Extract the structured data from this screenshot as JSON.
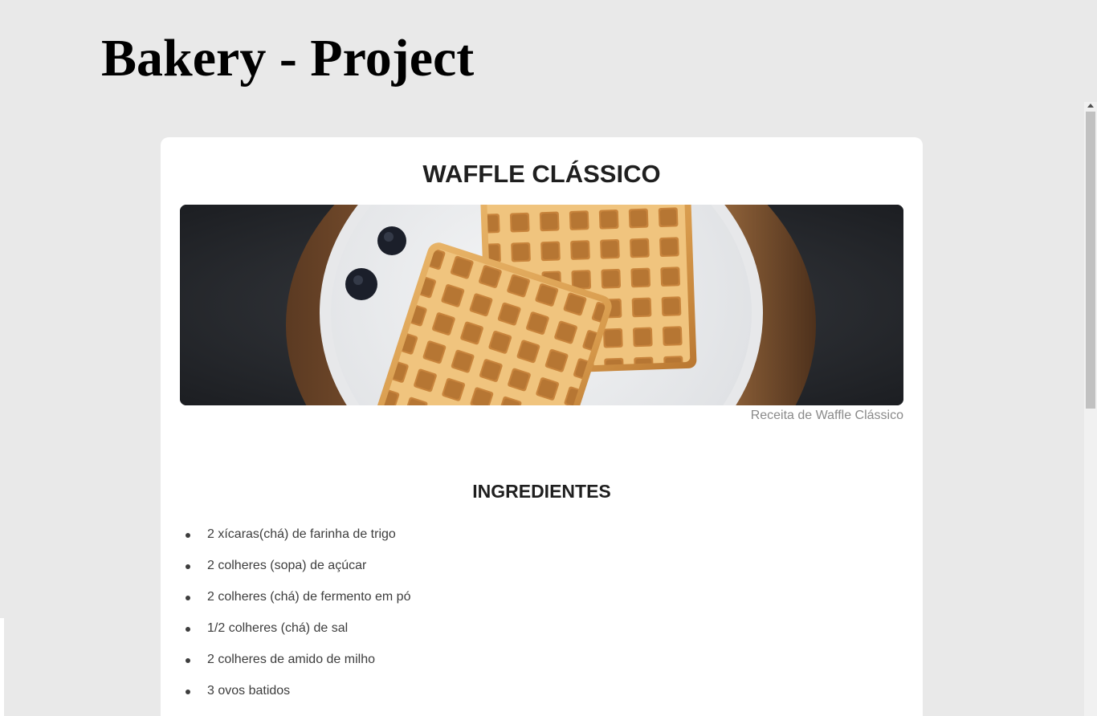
{
  "site": {
    "title": "Bakery - Project"
  },
  "recipe": {
    "title": "WAFFLE CLÁSSICO",
    "image_caption": "Receita de Waffle Clássico",
    "ingredients_title": "INGREDIENTES",
    "ingredients": [
      "2 xícaras(chá) de farinha de trigo",
      "2 colheres (sopa) de açúcar",
      "2 colheres (chá) de fermento em pó",
      "1/2 colheres (chá) de sal",
      "2 colheres de amido de milho",
      "3 ovos batidos"
    ]
  },
  "colors": {
    "page_background": "#e9e9e9",
    "card_background": "#ffffff",
    "heading_text": "#1f1f1f",
    "caption_text": "#8a8a8a",
    "list_text": "#3d3d3d"
  }
}
